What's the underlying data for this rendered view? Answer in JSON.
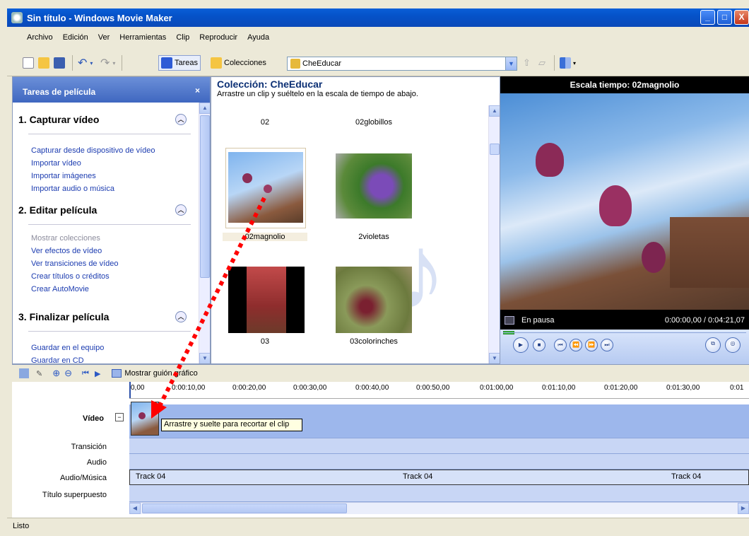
{
  "window": {
    "title": "Sin título - Windows Movie Maker",
    "min": "_",
    "max": "□",
    "close": "X"
  },
  "menu": [
    "Archivo",
    "Edición",
    "Ver",
    "Herramientas",
    "Clip",
    "Reproducir",
    "Ayuda"
  ],
  "toolbar": {
    "tareas": "Tareas",
    "colecciones": "Colecciones",
    "collection_value": "CheEducar"
  },
  "taskpane": {
    "title": "Tareas de película",
    "close": "×",
    "sections": [
      {
        "title": "1. Capturar vídeo",
        "links": [
          "Capturar desde dispositivo de vídeo",
          "Importar vídeo",
          "Importar imágenes",
          "Importar audio o música"
        ]
      },
      {
        "title": "2. Editar película",
        "links": [
          "Mostrar colecciones",
          "Ver efectos de vídeo",
          "Ver transiciones de vídeo",
          "Crear títulos o créditos",
          "Crear AutoMovie"
        ]
      },
      {
        "title": "3. Finalizar película",
        "links": [
          "Guardar en el equipo",
          "Guardar en CD"
        ]
      }
    ]
  },
  "collection": {
    "title": "Colección: CheEducar",
    "subtitle": "Arrastre un clip y suéltelo en la escala de tiempo de abajo.",
    "items": [
      "02",
      "02globillos",
      "02magnolio",
      "2violetas",
      "03",
      "03colorinches"
    ]
  },
  "preview": {
    "title": "Escala tiempo: 02magnolio",
    "status": "En pausa",
    "time": "0:00:00,00 / 0:04:21,07"
  },
  "timeline": {
    "storyboard_label": "Mostrar guión gráfico",
    "ruler": [
      "0,00",
      "0:00:10,00",
      "0:00:20,00",
      "0:00:30,00",
      "0:00:40,00",
      "0:00:50,00",
      "0:01:00,00",
      "0:01:10,00",
      "0:01:20,00",
      "0:01:30,00",
      "0:01"
    ],
    "tracks": {
      "video": "Vídeo",
      "transition": "Transición",
      "audio": "Audio",
      "music": "Audio/Música",
      "title": "Título superpuesto"
    },
    "music_clips": [
      "Track 04",
      "Track 04",
      "Track 04"
    ],
    "tooltip": "Arrastre y suelte para recortar el clip"
  },
  "status": "Listo",
  "colors": {
    "accent": "#0a5fd8",
    "link": "#1c3cb0",
    "track": "#c8d6f5",
    "arrow": "#ff0000"
  }
}
